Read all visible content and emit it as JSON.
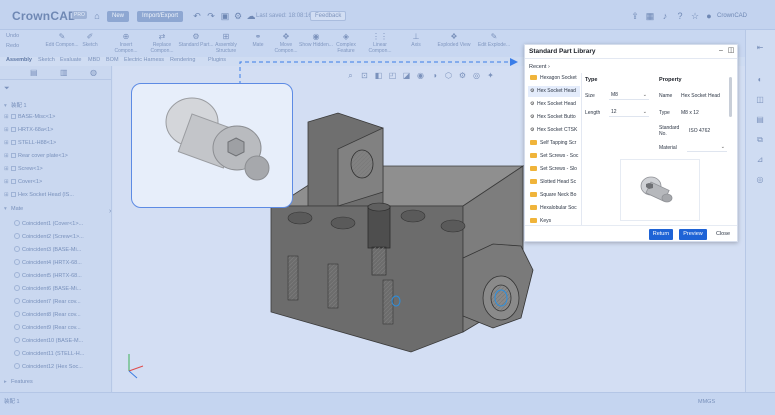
{
  "titlebar": {
    "app_name": "CrownCAD",
    "app_badge": "PRO",
    "new_label": "New",
    "import_export_label": "Import/Export",
    "save_status": "Last saved: 18:08:16",
    "feedback_label": "Feedback",
    "user_name": "CrownCAD"
  },
  "ribbon": {
    "undo": "Undo",
    "redo": "Redo",
    "edit": "Edit Compon...",
    "sketch": "Sketch",
    "insert": "Insert Compon...",
    "replace": "Replace Compon...",
    "standard": "Standard Part...",
    "assembly": "Assembly Structure",
    "mate": "Mate",
    "move": "Move Compon...",
    "show_hidden": "Show Hidden...",
    "complex": "Complex Feature",
    "linear": "Linear Compon...",
    "axis": "Axis",
    "exploded": "Exploded View",
    "edit_explode": "Edit Explode..."
  },
  "tabs": [
    "Assembly",
    "Sketch",
    "Evaluate",
    "MBD",
    "BOM",
    "Electric Harness",
    "Rendering",
    "Plugins"
  ],
  "tree": {
    "root": "装配 1",
    "items": [
      "BASE-Misc<1>",
      "HRTX-68a<1>",
      "STELL-H88<1>",
      "Rear cover plate<1>",
      "Screw<1>",
      "Cover<1>",
      "Hex Socket Head (IS..."
    ],
    "mates_label": "Mate",
    "mates": [
      "Coincident1 (Cover<1>...",
      "Coincident2 (Screw<1>...",
      "Coincident3 (BASE-Mi...",
      "Coincident4 (HRTX-68...",
      "Coincident5 (HRTX-68...",
      "Coincident6 (BASE-Mi...",
      "Coincident7 (Rear cov...",
      "Coincident8 (Rear cov...",
      "Coincident9 (Rear cov...",
      "Coincident10 (BASE-M...",
      "Coincident11 (STELL-H...",
      "Coincident12 (Hex Soc..."
    ],
    "features_label": "Features"
  },
  "bottom": {
    "tab_label": "装配 1",
    "units": "MMGS"
  },
  "dialog": {
    "title": "Standard Part Library",
    "recent": "Recent",
    "list": [
      {
        "label": "Hexagon Socket",
        "kind": "folder"
      },
      {
        "label": "Hex Socket Head",
        "kind": "bolt",
        "selected": true
      },
      {
        "label": "Hex Socket Head",
        "kind": "bolt"
      },
      {
        "label": "Hex Socket Butto",
        "kind": "bolt"
      },
      {
        "label": "Hex Socket CTSK",
        "kind": "bolt"
      },
      {
        "label": "Self Tapping Scr",
        "kind": "folder"
      },
      {
        "label": "Set Screws - Soc",
        "kind": "folder"
      },
      {
        "label": "Set Screws - Slo",
        "kind": "folder"
      },
      {
        "label": "Slotted Head Sc",
        "kind": "folder"
      },
      {
        "label": "Square Neck Bo",
        "kind": "folder"
      },
      {
        "label": "Hexalobular Soc",
        "kind": "folder"
      },
      {
        "label": "Keys",
        "kind": "folder"
      }
    ],
    "type_header": "Type",
    "size_label": "Size",
    "size_value": "M8",
    "length_label": "Length",
    "length_value": "12",
    "property_header": "Property",
    "name_label": "Name",
    "name_value": "Hex Socket Head",
    "type_label": "Type",
    "type_value": "M8 x 12",
    "std_label": "Standard No.",
    "std_value": "ISO 4762",
    "material_label": "Material",
    "material_value": "",
    "buttons": {
      "return": "Return",
      "preview": "Preview",
      "close": "Close"
    }
  }
}
